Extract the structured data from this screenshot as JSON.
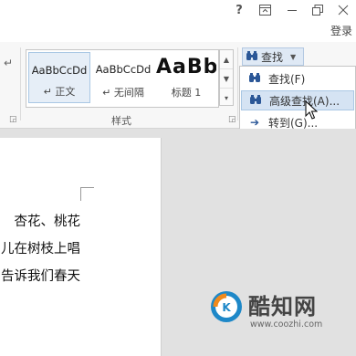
{
  "titlebar": {
    "help_icon": "?",
    "login_label": "登录"
  },
  "ribbon": {
    "styles_group_label": "样式",
    "styles": [
      {
        "sample": "AaBbCcDd",
        "label": "↵ 正文",
        "selected": true
      },
      {
        "sample": "AaBbCcDd",
        "label": "↵ 无间隔",
        "selected": false
      },
      {
        "sample": "AaBb",
        "label": "标题 1",
        "selected": false
      }
    ],
    "find_button_label": "查找"
  },
  "find_menu": {
    "items": [
      {
        "label": "查找(F)",
        "icon": "binoculars-icon"
      },
      {
        "label": "高级查找(A)...",
        "icon": "binoculars-icon"
      },
      {
        "label": "转到(G)...",
        "icon": "arrow-right-icon"
      }
    ]
  },
  "document": {
    "lines": [
      "杏花、桃花",
      "儿在树枝上唱",
      "告诉我们春天"
    ]
  },
  "watermark": {
    "name": "酷知网",
    "url": "www.coozhi.com"
  },
  "colors": {
    "accent": "#2b5797",
    "menu_hover": "#d5e3f3",
    "watermark_blue": "#1e88c8",
    "watermark_orange": "#f08a1c"
  }
}
